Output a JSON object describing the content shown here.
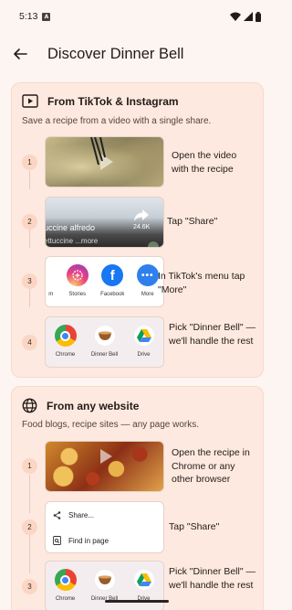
{
  "status": {
    "time": "5:13",
    "notif_badge": "A"
  },
  "app_bar": {
    "title": "Discover Dinner Bell"
  },
  "colors": {
    "background": "#fdf5f1",
    "card": "#fde9df",
    "badge": "#fbd6c4",
    "accent": "#231b17"
  },
  "section_social": {
    "icon": "video-frame-icon",
    "title": "From TikTok & Instagram",
    "subtitle": "Save a recipe from a video with a single share.",
    "steps": [
      {
        "num": "1",
        "text": "Open the video with the recipe"
      },
      {
        "num": "2",
        "text": "Tap \"Share\"",
        "caption_line1": "uccine alfredo",
        "caption_line2": "ettuccine ...more",
        "share_count": "24.6K"
      },
      {
        "num": "3",
        "text": "In TikTok's menu tap \"More\"",
        "share_targets": [
          "m",
          "Stories",
          "Facebook",
          "More"
        ]
      },
      {
        "num": "4",
        "text": "Pick \"Dinner Bell\" — we'll handle the rest",
        "apps": [
          "Chrome",
          "Dinner Bell",
          "Drive"
        ]
      }
    ]
  },
  "section_web": {
    "icon": "globe-icon",
    "title": "From any website",
    "subtitle": "Food blogs, recipe sites — any page works.",
    "steps": [
      {
        "num": "1",
        "text": "Open the recipe in Chrome or any other browser"
      },
      {
        "num": "2",
        "text": "Tap \"Share\"",
        "menu_items": [
          "Share...",
          "Find in page"
        ]
      },
      {
        "num": "3",
        "text": "Pick \"Dinner Bell\" — we'll handle the rest",
        "apps": [
          "Chrome",
          "Dinner Bell",
          "Drive"
        ]
      }
    ]
  }
}
